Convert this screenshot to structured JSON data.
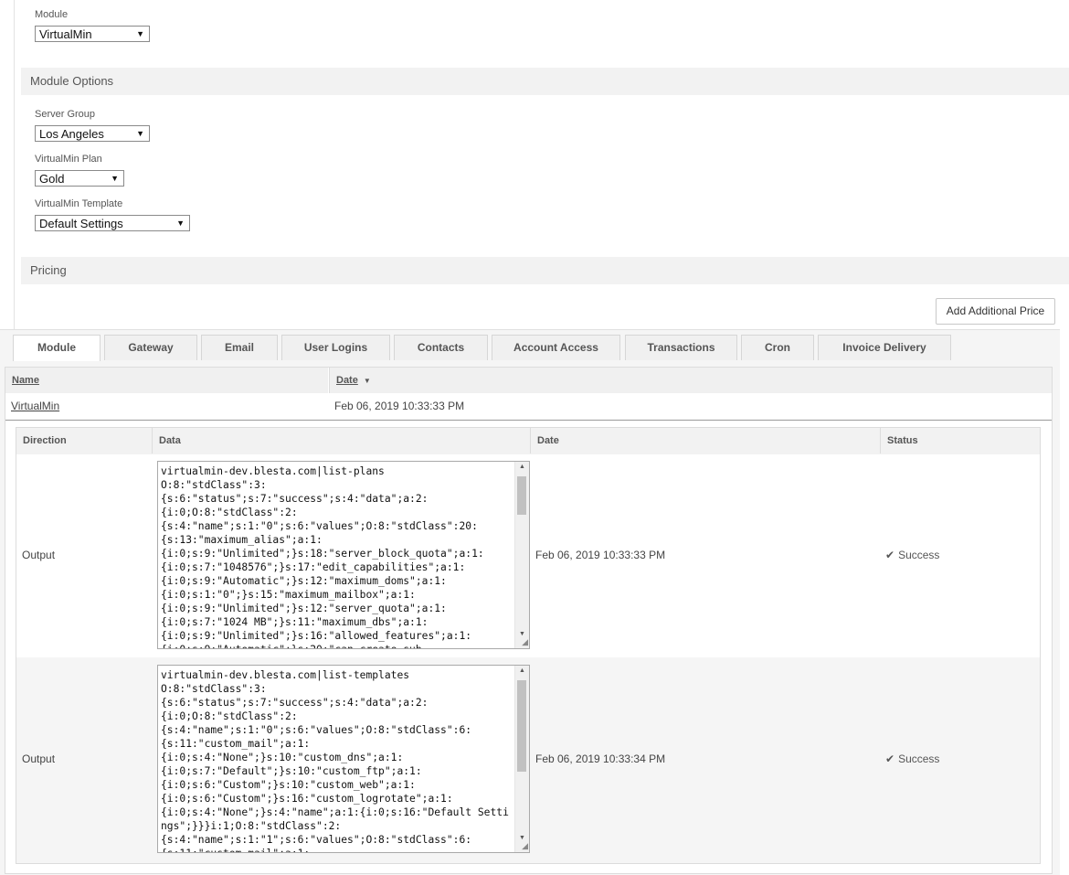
{
  "module_field": {
    "label": "Module",
    "value": "VirtualMin"
  },
  "module_options": {
    "title": "Module Options",
    "server_group": {
      "label": "Server Group",
      "value": "Los Angeles"
    },
    "plan": {
      "label": "VirtualMin Plan",
      "value": "Gold"
    },
    "template": {
      "label": "VirtualMin Template",
      "value": "Default Settings"
    }
  },
  "pricing": {
    "title": "Pricing",
    "add_price_button": "Add Additional Price"
  },
  "tabs": [
    "Module",
    "Gateway",
    "Email",
    "User Logins",
    "Contacts",
    "Account Access",
    "Transactions",
    "Cron",
    "Invoice Delivery"
  ],
  "log_table": {
    "columns": {
      "name": "Name",
      "date": "Date"
    },
    "row": {
      "name": "VirtualMin",
      "date": "Feb 06, 2019 10:33:33 PM"
    }
  },
  "detail_table": {
    "columns": {
      "direction": "Direction",
      "data": "Data",
      "date": "Date",
      "status": "Status"
    },
    "rows": [
      {
        "direction": "Output",
        "data": "virtualmin-dev.blesta.com|list-plans\nO:8:\"stdClass\":3:\n{s:6:\"status\";s:7:\"success\";s:4:\"data\";a:2:\n{i:0;O:8:\"stdClass\":2:\n{s:4:\"name\";s:1:\"0\";s:6:\"values\";O:8:\"stdClass\":20:\n{s:13:\"maximum_alias\";a:1:\n{i:0;s:9:\"Unlimited\";}s:18:\"server_block_quota\";a:1:\n{i:0;s:7:\"1048576\";}s:17:\"edit_capabilities\";a:1:\n{i:0;s:9:\"Automatic\";}s:12:\"maximum_doms\";a:1:\n{i:0;s:1:\"0\";}s:15:\"maximum_mailbox\";a:1:\n{i:0;s:9:\"Unlimited\";}s:12:\"server_quota\";a:1:\n{i:0;s:7:\"1024 MB\";}s:11:\"maximum_dbs\";a:1:\n{i:0;s:9:\"Unlimited\";}s:16:\"allowed_features\";a:1:\n{i:0;s:9:\"Automatic\";}s:20:\"can_create_sub",
        "date": "Feb 06, 2019 10:33:33 PM",
        "status": "Success"
      },
      {
        "direction": "Output",
        "data": "virtualmin-dev.blesta.com|list-templates\nO:8:\"stdClass\":3:\n{s:6:\"status\";s:7:\"success\";s:4:\"data\";a:2:\n{i:0;O:8:\"stdClass\":2:\n{s:4:\"name\";s:1:\"0\";s:6:\"values\";O:8:\"stdClass\":6:\n{s:11:\"custom_mail\";a:1:\n{i:0;s:4:\"None\";}s:10:\"custom_dns\";a:1:\n{i:0;s:7:\"Default\";}s:10:\"custom_ftp\";a:1:\n{i:0;s:6:\"Custom\";}s:10:\"custom_web\";a:1:\n{i:0;s:6:\"Custom\";}s:16:\"custom_logrotate\";a:1:\n{i:0;s:4:\"None\";}s:4:\"name\";a:1:{i:0;s:16:\"Default Settings\";}}}i:1;O:8:\"stdClass\":2:\n{s:4:\"name\";s:1:\"1\";s:6:\"values\";O:8:\"stdClass\":6:\n{s:11:\"custom_mail\";a:1:",
        "date": "Feb 06, 2019 10:33:34 PM",
        "status": "Success"
      }
    ]
  },
  "colors": {
    "link": "#2a6ebb",
    "section_bg": "#f2f2f2"
  }
}
